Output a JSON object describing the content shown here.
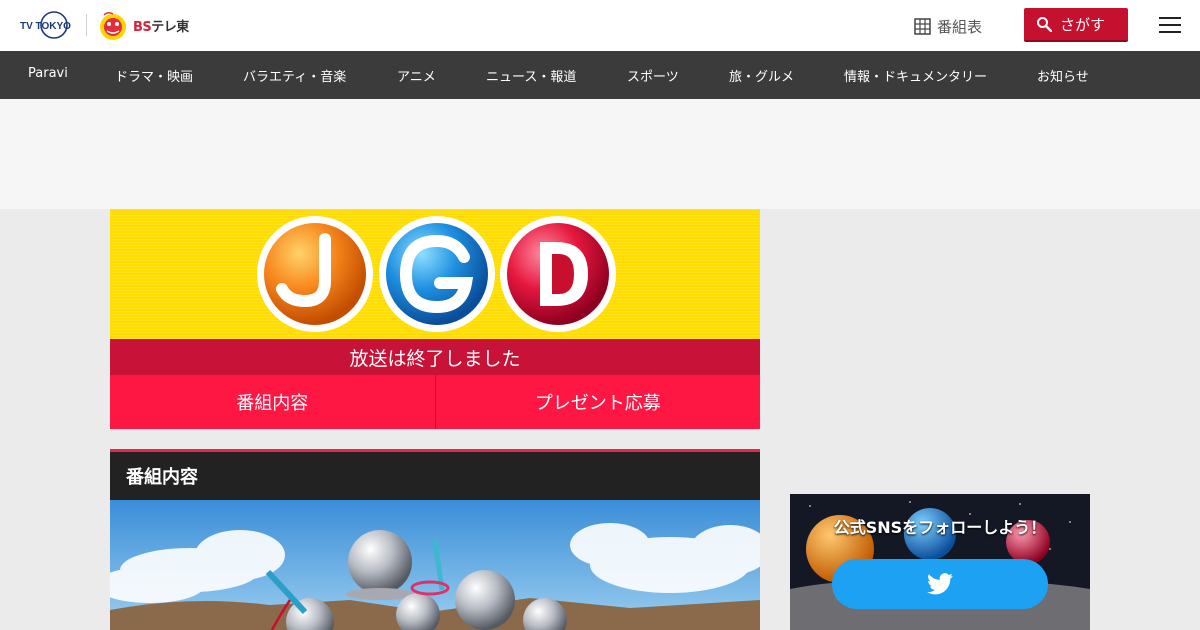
{
  "header": {
    "logo_tvtokyo": "TV TOKYO",
    "logo_bs_prefix": "BS",
    "logo_bs_suffix": "テレ東",
    "guide_label": "番組表",
    "search_label": "さがす"
  },
  "nav": {
    "items": [
      "Paravi",
      "ドラマ・映画",
      "バラエティ・音楽",
      "アニメ",
      "ニュース・報道",
      "スポーツ",
      "旅・グルメ",
      "情報・ドキュメンタリー",
      "お知らせ"
    ]
  },
  "program": {
    "status": "放送は終了しました",
    "tabs": [
      "番組内容",
      "プレゼント応募"
    ]
  },
  "section": {
    "title": "番組内容"
  },
  "sns": {
    "title": "公式SNSをフォローしよう！"
  },
  "colors": {
    "accent_red": "#c5102f",
    "tab_red": "#ff1744",
    "nav_bg": "#3b3b3b",
    "hero_yellow": "#ffdd00",
    "twitter_blue": "#1da1f2"
  },
  "icons": [
    "grid-icon",
    "search-icon",
    "hamburger-menu-icon",
    "twitter-icon"
  ]
}
